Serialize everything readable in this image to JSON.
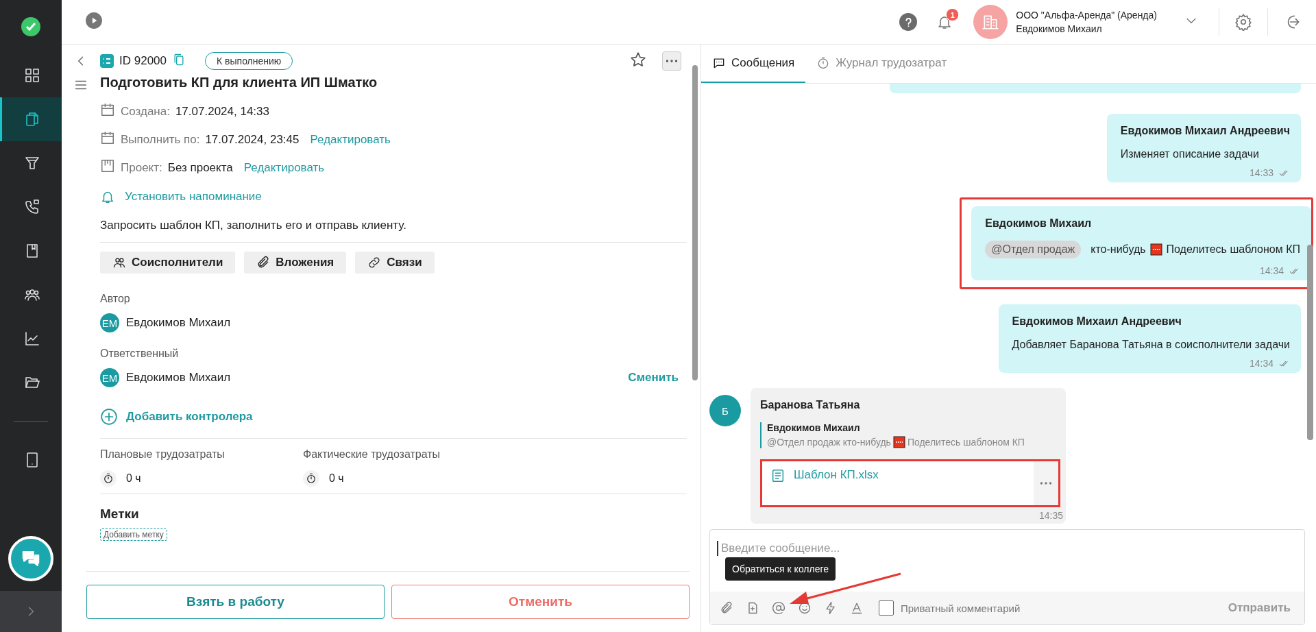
{
  "sidebar": {
    "items": [
      {
        "selected": false
      },
      {
        "selected": true
      },
      {
        "selected": false
      },
      {
        "selected": false
      },
      {
        "selected": false
      },
      {
        "selected": false
      },
      {
        "selected": false
      },
      {
        "selected": false
      }
    ],
    "bottom_items": [
      {
        "selected": false
      }
    ]
  },
  "header": {
    "notifications": {
      "count": "1"
    },
    "account": {
      "company": "ООО \"Альфа-Аренда\" (Аренда)",
      "user": "Евдокимов Михаил"
    }
  },
  "task": {
    "id": "ID 92000",
    "status": "К выполнению",
    "starred": false,
    "title": "Подготовить КП для клиента ИП Шматко",
    "meta": [
      {
        "label": "Создана:",
        "value": "17.07.2024, 14:33"
      },
      {
        "label": "Выполнить по:",
        "value": "17.07.2024, 23:45",
        "action": "Редактировать"
      },
      {
        "label": "Проект:",
        "value": "Без проекта",
        "action": "Редактировать"
      }
    ],
    "reminder": "Установить напоминание",
    "description": "Запросить шаблон КП, заполнить его и отправь клиенту.",
    "tabs": [
      "Соисполнители",
      "Вложения",
      "Связи"
    ],
    "author": {
      "label": "Автор",
      "initials": "ЕМ",
      "name": "Евдокимов Михаил"
    },
    "assignee": {
      "label": "Ответственный",
      "initials": "ЕМ",
      "name": "Евдокимов Михаил",
      "action": "Сменить"
    },
    "add_controller": "Добавить контролера",
    "effort": [
      {
        "label": "Плановые трудозатраты",
        "value": "0 ч"
      },
      {
        "label": "Фактические трудозатраты",
        "value": "0 ч"
      }
    ],
    "tags": {
      "title": "Метки",
      "add": "Добавить метку"
    },
    "buttons": [
      {
        "label": "Взять в работу",
        "kind": "primary"
      },
      {
        "label": "Отменить",
        "kind": "danger"
      }
    ]
  },
  "chat": {
    "tabs": [
      {
        "label": "Сообщения",
        "selected": true
      },
      {
        "label": "Журнал трудозатрат",
        "selected": false
      }
    ],
    "messages": [
      {
        "kind": "event",
        "author": "Евдокимов Михаил Андреевич",
        "text": "Изменяет описание задачи",
        "time": "14:33",
        "read": true,
        "highlighted": false
      },
      {
        "kind": "mention",
        "author": "Евдокимов Михаил",
        "mention": "@Отдел продаж",
        "text": "кто-нибудь",
        "text_after": "Поделитесь шаблоном КП",
        "time": "14:34",
        "read": true,
        "highlighted": true
      },
      {
        "kind": "event",
        "author": "Евдокимов Михаил Андреевич",
        "text": "Добавляет Баранова Татьяна в соисполнители задачи",
        "time": "14:34",
        "read": true,
        "highlighted": false
      },
      {
        "kind": "reply",
        "initials": "Б",
        "author": "Баранова Татьяна",
        "quote_author": "Евдокимов Михаил",
        "quote_text": "@Отдел продаж кто-нибудь",
        "quote_after": "Поделитесь шаблоном КП",
        "file": "Шаблон КП.xlsx",
        "file_highlighted": true,
        "time": "14:35"
      }
    ],
    "input": {
      "placeholder": "Введите сообщение...",
      "tooltip": "Обратиться к коллеге",
      "private": {
        "label": "Приватный комментарий",
        "checked": false
      },
      "send": {
        "label": "Отправить",
        "disabled": true
      }
    }
  }
}
